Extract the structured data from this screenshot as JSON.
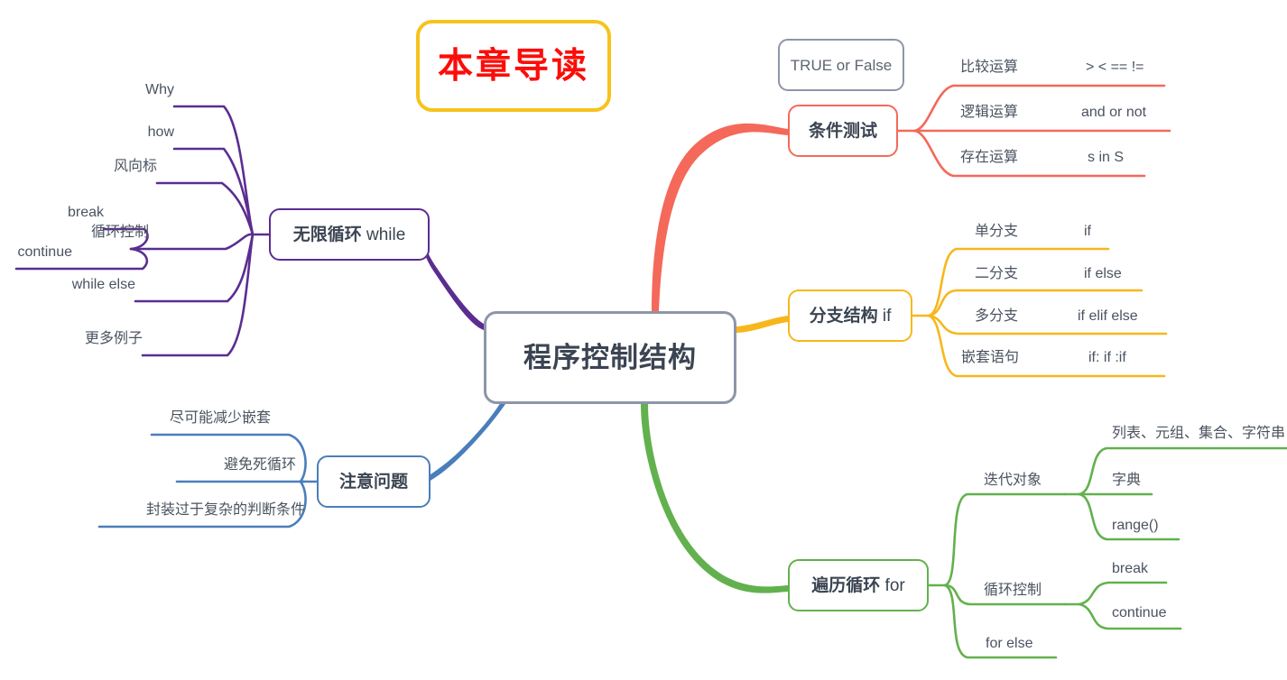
{
  "title_banner": {
    "text": "本章导读",
    "border_color": "#f7c31c",
    "text_color": "#fb0d09"
  },
  "center": {
    "text": "程序控制结构",
    "border_color": "#8d96a8"
  },
  "floating": {
    "text": "TRUE or False",
    "border_color": "#8d96a8"
  },
  "branches": {
    "while": {
      "label_bold": "无限循环",
      "label_plain": "while",
      "color": "#5b2d91",
      "items": [
        {
          "label": "Why"
        },
        {
          "label": "how"
        },
        {
          "label": "风向标"
        },
        {
          "label": "循环控制",
          "children": [
            {
              "label": "break"
            },
            {
              "label": "continue"
            }
          ]
        },
        {
          "label": "while  else"
        },
        {
          "label": "更多例子"
        }
      ]
    },
    "note": {
      "label_bold": "注意问题",
      "label_plain": "",
      "color": "#4a7ebb",
      "items": [
        {
          "label": "尽可能减少嵌套"
        },
        {
          "label": "避免死循环"
        },
        {
          "label": "封装过于复杂的判断条件"
        }
      ]
    },
    "condition": {
      "label_bold": "条件测试",
      "label_plain": "",
      "color": "#f4695a",
      "items": [
        {
          "label": "比较运算",
          "value": ">  <  ==  !="
        },
        {
          "label": "逻辑运算",
          "value": "and  or  not"
        },
        {
          "label": "存在运算",
          "value": "s in S"
        }
      ]
    },
    "ifstruct": {
      "label_bold": "分支结构",
      "label_plain": "if",
      "color": "#f7b71c",
      "items": [
        {
          "label": "单分支",
          "value": "if"
        },
        {
          "label": "二分支",
          "value": "if   else"
        },
        {
          "label": "多分支",
          "value": "if  elif  else"
        },
        {
          "label": "嵌套语句",
          "value": "if:  if :if"
        }
      ]
    },
    "forloop": {
      "label_bold": "遍历循环",
      "label_plain": "for",
      "color": "#62b14e",
      "items": [
        {
          "label": "迭代对象",
          "children": [
            {
              "label": "列表、元组、集合、字符串"
            },
            {
              "label": "字典"
            },
            {
              "label": "range()"
            }
          ]
        },
        {
          "label": "循环控制",
          "children": [
            {
              "label": "break"
            },
            {
              "label": "continue"
            }
          ]
        },
        {
          "label": "for   else"
        }
      ]
    }
  }
}
